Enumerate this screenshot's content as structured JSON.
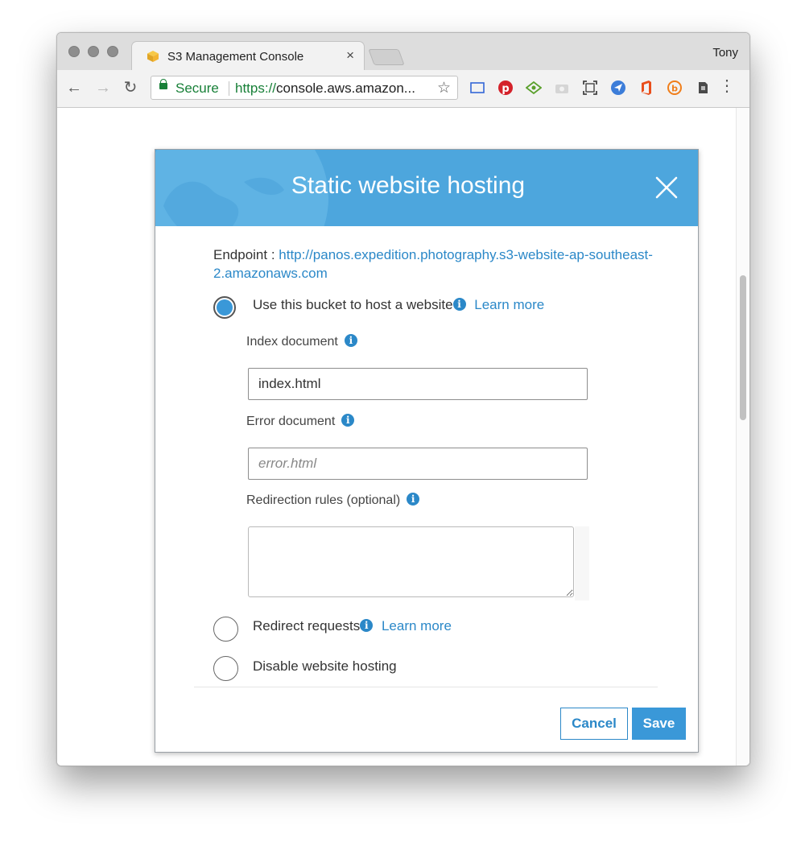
{
  "browser": {
    "tab_title": "S3 Management Console",
    "tab_close": "×",
    "user": "Tony",
    "secure_label": "Secure",
    "url_scheme": "https://",
    "url_rest": "console.aws.amazon...",
    "extensions": [
      "cast-icon",
      "pinterest-icon",
      "eye-icon",
      "camera-icon",
      "screenshot-icon",
      "send-icon",
      "office-icon",
      "b-icon",
      "evernote-icon"
    ]
  },
  "modal": {
    "title": "Static website hosting",
    "endpoint_label": "Endpoint : ",
    "endpoint_url": "http://panos.expedition.photography.s3-website-ap-southeast-2.amazonaws.com",
    "options": {
      "host": {
        "label": "Use this bucket to host a website",
        "learn_more": "Learn more",
        "selected": true
      },
      "redirect": {
        "label": "Redirect requests",
        "learn_more": "Learn more",
        "selected": false
      },
      "disable": {
        "label": "Disable website hosting",
        "selected": false
      }
    },
    "index_document": {
      "label": "Index document",
      "value": "index.html"
    },
    "error_document": {
      "label": "Error document",
      "placeholder": "error.html",
      "value": ""
    },
    "redirection_rules": {
      "label": "Redirection rules (optional)",
      "value": ""
    },
    "cancel_label": "Cancel",
    "save_label": "Save"
  },
  "colors": {
    "header_blue": "#4da6dd",
    "link_blue": "#2b88c8",
    "button_blue": "#3a98d8"
  }
}
